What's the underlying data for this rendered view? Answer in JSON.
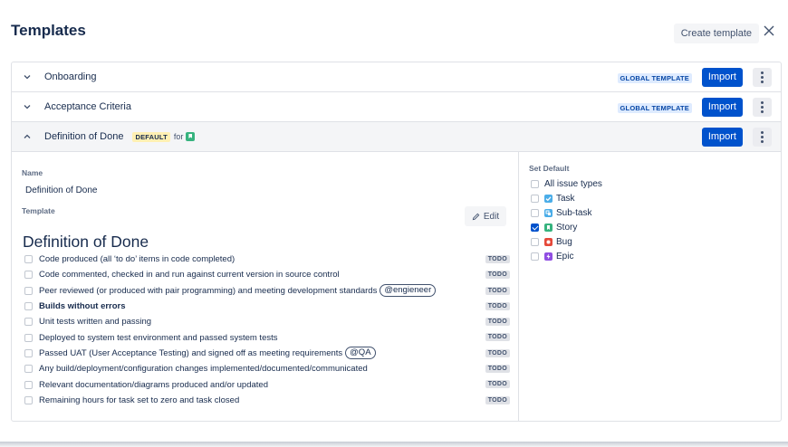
{
  "header": {
    "title": "Templates",
    "create_label": "Create template",
    "close_icon": "close-icon"
  },
  "templates": [
    {
      "title": "Onboarding",
      "badge": "GLOBAL TEMPLATE",
      "import_label": "Import",
      "expanded": false
    },
    {
      "title": "Acceptance Criteria",
      "badge": "GLOBAL TEMPLATE",
      "import_label": "Import",
      "expanded": false
    },
    {
      "title": "Definition of Done",
      "default_badge": "DEFAULT",
      "for_text": "for",
      "import_label": "Import",
      "expanded": true
    }
  ],
  "detail": {
    "name_label": "Name",
    "name_value": "Definition of Done",
    "template_label": "Template",
    "edit_label": "Edit",
    "heading": "Definition of Done",
    "items": [
      {
        "text": "Code produced (all ‘to do’ items in code completed)",
        "status": "TODO"
      },
      {
        "text": "Code commented, checked in and run against current version in source control",
        "status": "TODO"
      },
      {
        "text": "Peer reviewed (or produced with pair programming) and meeting development standards",
        "mention": "@engieneer",
        "status": "TODO"
      },
      {
        "text": "Builds without errors",
        "bold": true,
        "status": "TODO"
      },
      {
        "text": "Unit tests written and passing",
        "status": "TODO"
      },
      {
        "text": "Deployed to system test environment and passed system tests",
        "status": "TODO"
      },
      {
        "text": "Passed UAT (User Acceptance Testing) and signed off as meeting requirements",
        "mention": "@QA",
        "status": "TODO"
      },
      {
        "text": "Any build/deployment/configuration changes implemented/documented/communicated",
        "status": "TODO"
      },
      {
        "text": "Relevant documentation/diagrams produced and/or updated",
        "status": "TODO"
      },
      {
        "text": "Remaining hours for task set to zero and task closed",
        "status": "TODO"
      }
    ]
  },
  "set_default": {
    "label": "Set Default",
    "options": [
      {
        "label": "All issue types",
        "checked": false,
        "icon": null
      },
      {
        "label": "Task",
        "checked": false,
        "icon": "task-icon",
        "color": "#4bade8"
      },
      {
        "label": "Sub-task",
        "checked": false,
        "icon": "subtask-icon",
        "color": "#4bade8"
      },
      {
        "label": "Story",
        "checked": true,
        "icon": "story-icon",
        "color": "#36b37e"
      },
      {
        "label": "Bug",
        "checked": false,
        "icon": "bug-icon",
        "color": "#e5493a"
      },
      {
        "label": "Epic",
        "checked": false,
        "icon": "epic-icon",
        "color": "#904ee2"
      }
    ]
  },
  "colors": {
    "primary": "#0052cc",
    "text": "#172b4d",
    "border": "#dfe1e6",
    "default_badge_bg": "#fff0b3",
    "global_badge_bg": "#deebff"
  }
}
